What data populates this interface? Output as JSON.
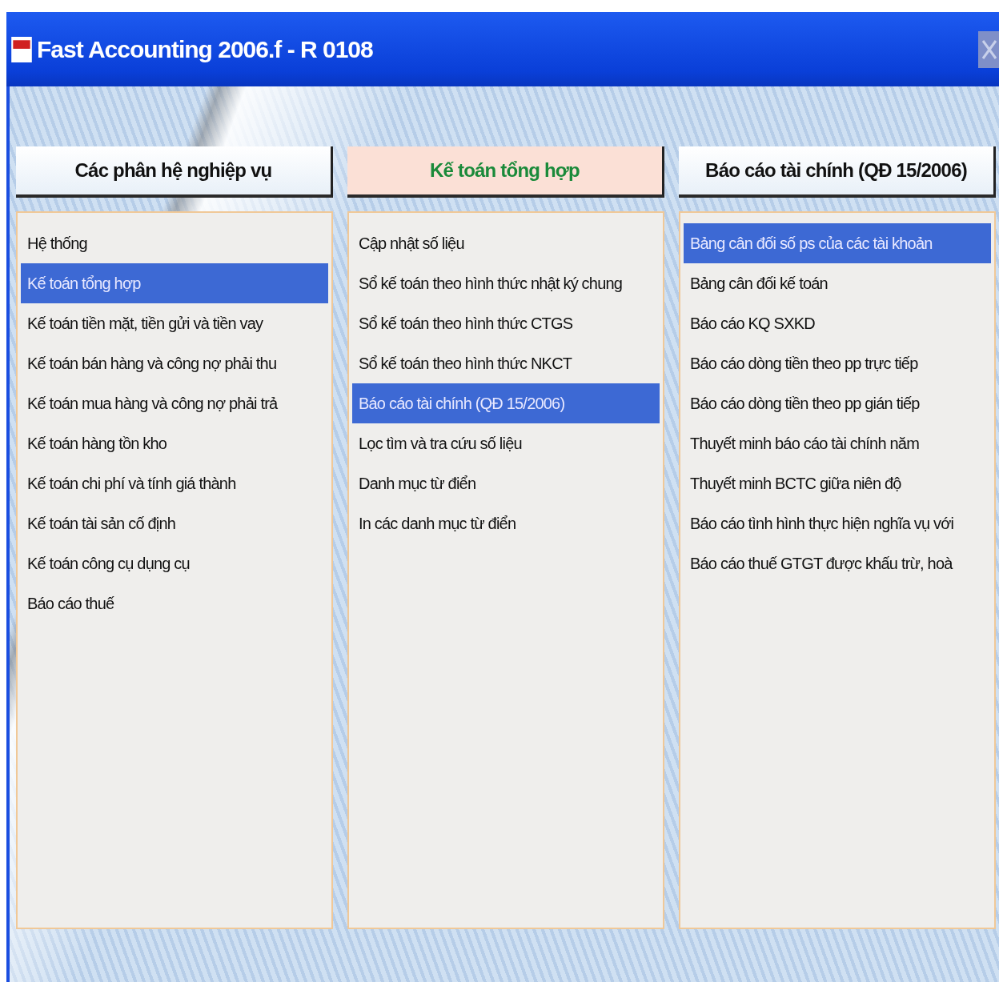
{
  "window": {
    "title": "Fast Accounting 2006.f - R 0108"
  },
  "columns": [
    {
      "header": "Các phân hệ nghiệp vụ",
      "selected": false,
      "items": [
        {
          "label": "Hệ thống",
          "selected": false
        },
        {
          "label": "Kế toán tổng hợp",
          "selected": true
        },
        {
          "label": "Kế toán tiền mặt, tiền gửi và tiền vay",
          "selected": false
        },
        {
          "label": "Kế toán bán hàng và công nợ phải thu",
          "selected": false
        },
        {
          "label": "Kế toán mua hàng và công nợ phải trả",
          "selected": false
        },
        {
          "label": "Kế toán hàng tồn kho",
          "selected": false
        },
        {
          "label": "Kế toán chi phí và tính giá thành",
          "selected": false
        },
        {
          "label": "Kế toán tài sản cố định",
          "selected": false
        },
        {
          "label": "Kế toán công cụ dụng cụ",
          "selected": false
        },
        {
          "label": "Báo cáo thuế",
          "selected": false
        }
      ]
    },
    {
      "header": "Kế toán tổng hợp",
      "selected": true,
      "items": [
        {
          "label": "Cập nhật số liệu",
          "selected": false
        },
        {
          "label": "Sổ kế toán theo hình thức nhật ký chung",
          "selected": false
        },
        {
          "label": "Sổ kế toán theo hình thức CTGS",
          "selected": false
        },
        {
          "label": "Sổ kế toán theo hình thức NKCT",
          "selected": false
        },
        {
          "label": "Báo cáo tài chính (QĐ 15/2006)",
          "selected": true
        },
        {
          "label": "Lọc tìm và tra cứu số liệu",
          "selected": false
        },
        {
          "label": "Danh mục từ điển",
          "selected": false
        },
        {
          "label": "In các danh mục từ điển",
          "selected": false
        }
      ]
    },
    {
      "header": "Báo cáo tài chính (QĐ 15/2006)",
      "selected": false,
      "items": [
        {
          "label": "Bảng cân đối số ps của các tài khoản",
          "selected": true
        },
        {
          "label": "Bảng cân đối kế toán",
          "selected": false
        },
        {
          "label": "Báo cáo KQ SXKD",
          "selected": false
        },
        {
          "label": "Báo cáo dòng tiền theo pp trực tiếp",
          "selected": false
        },
        {
          "label": "Báo cáo dòng tiền theo pp gián tiếp",
          "selected": false
        },
        {
          "label": "Thuyết minh báo cáo tài chính năm",
          "selected": false
        },
        {
          "label": "Thuyết minh BCTC giữa niên độ",
          "selected": false
        },
        {
          "label": "Báo cáo tình hình thực hiện nghĩa vụ với",
          "selected": false
        },
        {
          "label": "Báo cáo thuế GTGT được khấu trừ, hoà",
          "selected": false
        }
      ]
    }
  ]
}
